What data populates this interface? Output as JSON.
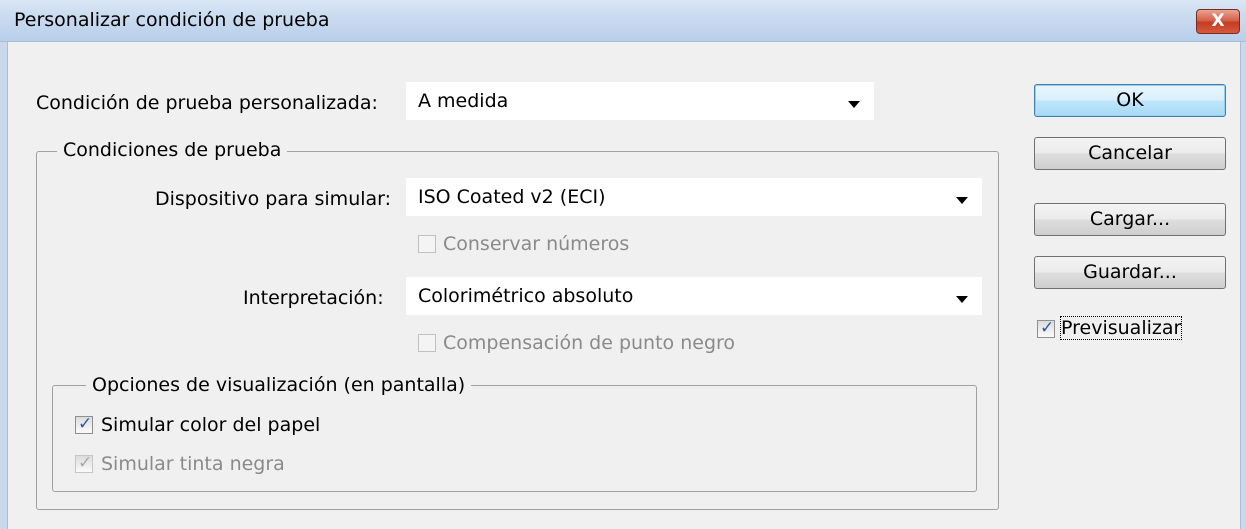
{
  "window": {
    "title": "Personalizar condición de prueba",
    "close_label": "X"
  },
  "custom_condition": {
    "label": "Condición de prueba personalizada:",
    "value": "A medida"
  },
  "proof_conditions": {
    "legend": "Condiciones de prueba",
    "device": {
      "label": "Dispositivo para simular:",
      "value": "ISO Coated v2 (ECI)"
    },
    "preserve_numbers": {
      "label": "Conservar números",
      "checked": false,
      "enabled": false
    },
    "intent": {
      "label": "Interpretación:",
      "value": "Colorimétrico absoluto"
    },
    "black_point": {
      "label": "Compensación de punto negro",
      "checked": false,
      "enabled": false
    }
  },
  "display_options": {
    "legend": "Opciones de visualización (en pantalla)",
    "paper_color": {
      "label": "Simular color del papel",
      "checked": true,
      "enabled": true
    },
    "black_ink": {
      "label": "Simular tinta negra",
      "checked": true,
      "enabled": false
    }
  },
  "buttons": {
    "ok": "OK",
    "cancel": "Cancelar",
    "load": "Cargar...",
    "save": "Guardar..."
  },
  "preview": {
    "label": "Previsualizar",
    "checked": true
  }
}
